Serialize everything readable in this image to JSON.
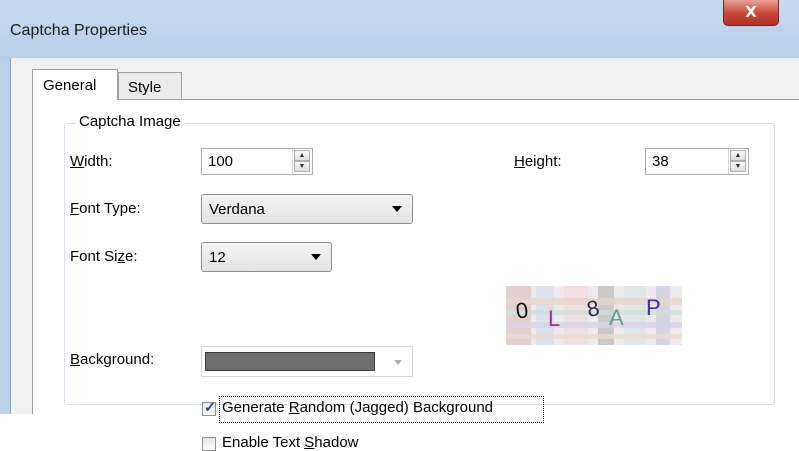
{
  "window": {
    "title": "Captcha Properties",
    "close_glyph": "X"
  },
  "tabs": [
    {
      "label": "General",
      "active": true
    },
    {
      "label": "Style",
      "active": false
    }
  ],
  "group": {
    "title": "Captcha Image"
  },
  "fields": {
    "width": {
      "label_u": "W",
      "label_rest": "idth:",
      "value": "100"
    },
    "height": {
      "label_u": "H",
      "label_rest": "eight:",
      "value": "38"
    },
    "font_type": {
      "label_u": "F",
      "label_rest": "ont Type:",
      "value": "Verdana"
    },
    "font_size": {
      "label_pre": "Font Si",
      "label_u": "z",
      "label_rest": "e:",
      "value": "12"
    },
    "background": {
      "label_u": "B",
      "label_rest": "ackground:",
      "color": "#6e6e6e"
    }
  },
  "checkboxes": {
    "jagged": {
      "pre": "Generate ",
      "u": "R",
      "post": "andom (Jagged) Background",
      "checked": true
    },
    "shadow": {
      "pre": "Enable Text ",
      "u": "S",
      "post": "hadow",
      "checked": false
    }
  },
  "captcha_preview": {
    "characters": [
      "0",
      "L",
      "8",
      "A",
      "P"
    ]
  },
  "colors": {
    "title_bar": "#b9d1ea",
    "close_button": "#c7473a",
    "dialog_face": "#f0f0f0",
    "check_mark": "#243f84"
  }
}
